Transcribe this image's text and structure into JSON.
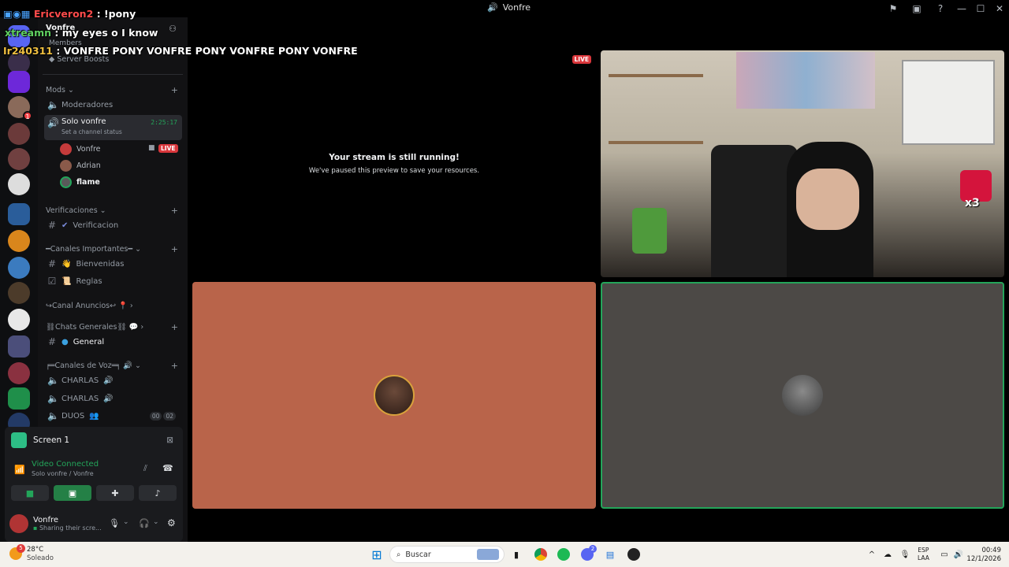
{
  "window": {
    "title": "Vonfre"
  },
  "chat_overlay": [
    {
      "user": "Ericveron2",
      "sep": " : ",
      "msg": "!pony"
    },
    {
      "user": "xtreamn",
      "sep": " : ",
      "msg": "my eyes o I know"
    },
    {
      "user": "Ir240311",
      "sep": " : ",
      "msg": "VONFRE PONY  VONFRE PONY  VONFRE PONY  VONFRE"
    }
  ],
  "server_header": {
    "name": "Vonfre",
    "members": "Members",
    "boosts": "Server Boosts"
  },
  "channels": {
    "mods": {
      "label": "Mods"
    },
    "moderadores": "Moderadores",
    "solo": {
      "name": "Solo vonfre",
      "time": "2:25:17",
      "status_hint": "Set a channel status"
    },
    "voice_users": [
      {
        "name": "Vonfre",
        "live": "LIVE"
      },
      {
        "name": "Adrian"
      },
      {
        "name": "flame"
      }
    ],
    "verificaciones": {
      "label": "Verificaciones",
      "channel": "Verificacion"
    },
    "importantes": {
      "label": "━Canales Importantes━",
      "bienvenidas": "Bienvenidas",
      "reglas": "Reglas"
    },
    "anuncios": {
      "label": "↪Canal Anuncios↩"
    },
    "generales": {
      "label": "⛓Chats Generales⛓",
      "general": "General"
    },
    "voz": {
      "label": "╒═Canales de Voz═╕",
      "charlas1": "CHARLAS",
      "charlas2": "CHARLAS",
      "duos": "DUOS",
      "duos_count_a": "00",
      "duos_count_b": "02"
    }
  },
  "panel": {
    "screen": "Screen 1",
    "status": "Video Connected",
    "location": "Solo vonfre / Vonfre",
    "user": "Vonfre",
    "user_status": "Sharing their scre..."
  },
  "stage": {
    "paused_title": "Your stream is still running!",
    "paused_sub": "We've paused this preview to save your resources.",
    "live": "LIVE",
    "cam_overlay": "x3"
  },
  "taskbar": {
    "weather_temp": "28°C",
    "weather_desc": "Soleado",
    "search": "Buscar",
    "lang1": "ESP",
    "lang2": "LAA",
    "time": "00:49",
    "date": "12/1/2026",
    "notif": "5",
    "discord_badge": "2"
  },
  "colors": {
    "accent_green": "#23a55a",
    "live_red": "#da373c",
    "tile_orange": "#b9644a",
    "tile_grey": "#4c4946"
  }
}
